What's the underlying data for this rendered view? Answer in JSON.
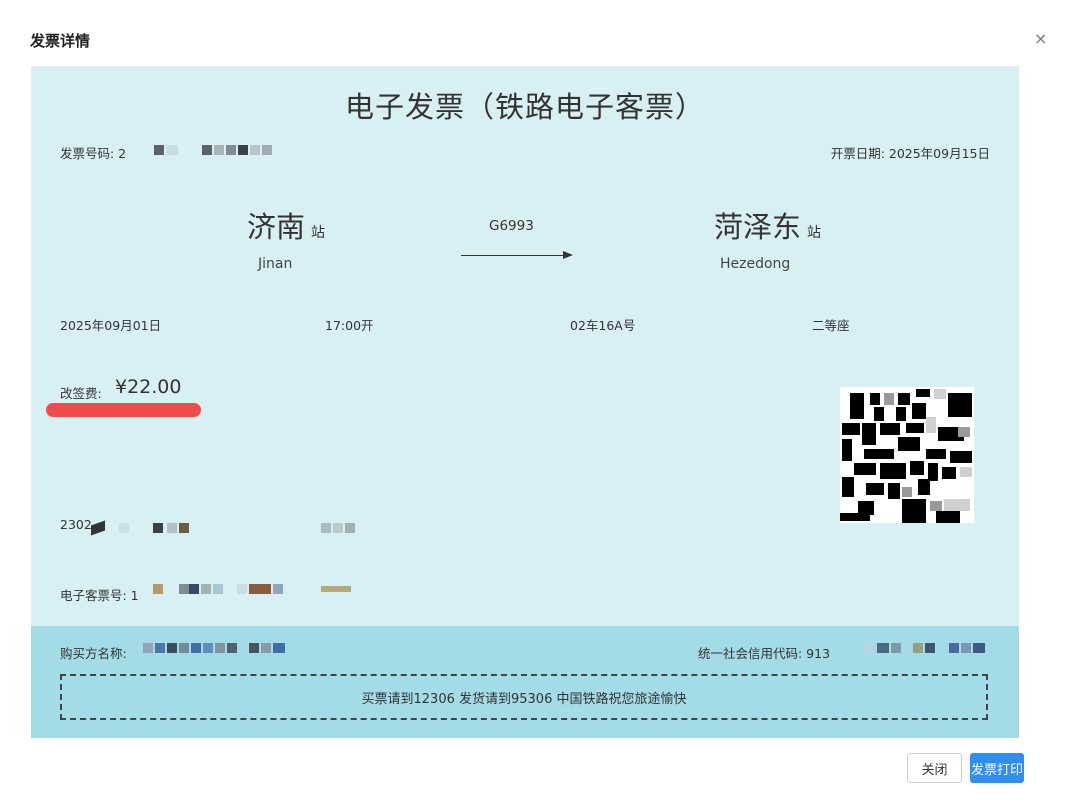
{
  "dialog": {
    "title": "发票详情",
    "close_icon": "×"
  },
  "invoice": {
    "title": "电子发票（铁路电子客票）",
    "invoice_no_label": "发票号码: 2",
    "issue_date": "开票日期: 2025年09月15日",
    "from_station": "济南",
    "from_pinyin": "Jinan",
    "station_suffix": "站",
    "train_no": "G6993",
    "to_station": "菏泽东",
    "to_pinyin": "Hezedong",
    "travel_date": "2025年09月01日",
    "depart_time": "17:00开",
    "seat_no": "02车16A号",
    "seat_class": "二等座",
    "fee_label": "改签费:",
    "fee_amount": "¥22.00",
    "id_prefix": "2302",
    "eticket_label": "电子客票号: 1",
    "buyer_label": "购买方名称:",
    "credit_code_label": "统一社会信用代码: 913",
    "notice": "买票请到12306 发货请到95306 中国铁路祝您旅途愉快"
  },
  "buttons": {
    "close": "关闭",
    "print": "发票打印"
  },
  "colors": {
    "invoice_bg": "#d8f0f4",
    "footer_bg": "#a3dbe6",
    "primary": "#2f8ef0",
    "highlight": "#f04c4c"
  }
}
